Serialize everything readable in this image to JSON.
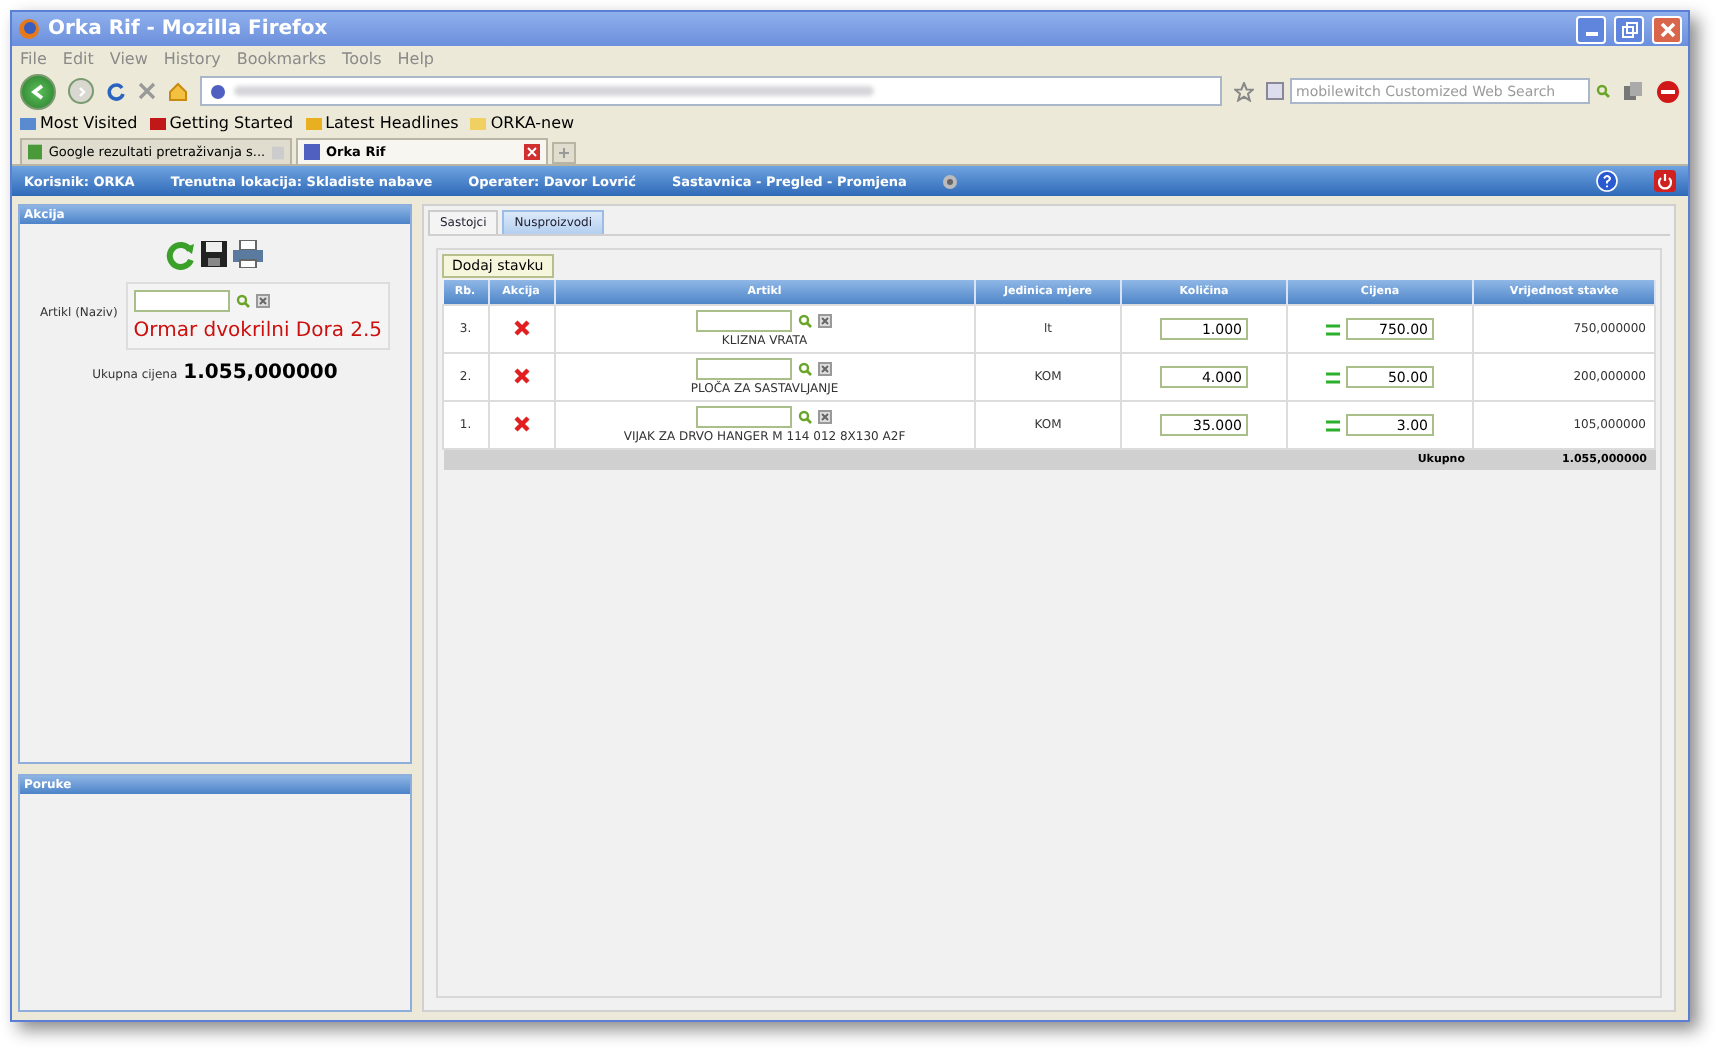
{
  "window": {
    "title": "Orka Rif - Mozilla Firefox"
  },
  "menu": [
    "File",
    "Edit",
    "View",
    "History",
    "Bookmarks",
    "Tools",
    "Help"
  ],
  "search": {
    "placeholder": "mobilewitch Customized Web Search"
  },
  "bookmarks": [
    {
      "label": "Most Visited"
    },
    {
      "label": "Getting Started"
    },
    {
      "label": "Latest Headlines"
    },
    {
      "label": "ORKA-new"
    }
  ],
  "browser_tabs": [
    {
      "label": "Google rezultati pretraživanja s...",
      "selected": false
    },
    {
      "label": "Orka Rif",
      "selected": true
    }
  ],
  "app_bar": {
    "items": [
      "Korisnik: ORKA",
      "Trenutna lokacija: Skladiste nabave",
      "Operater: Davor Lovrić",
      "Sastavnica - Pregled - Promjena"
    ]
  },
  "akcija_panel": {
    "title": "Akcija",
    "artikl_label": "Artikl (Naziv)",
    "product_name": "Ormar dvokrilni Dora 2.5",
    "total_label": "Ukupna cijena",
    "total_value": "1.055,000000"
  },
  "poruke_panel": {
    "title": "Poruke"
  },
  "content_tabs": [
    {
      "label": "Sastojci",
      "selected": true
    },
    {
      "label": "Nusproizvodi",
      "selected": false
    }
  ],
  "add_button": "Dodaj stavku",
  "table": {
    "columns": [
      "Rb.",
      "Akcija",
      "Artikl",
      "Jedinica mjere",
      "Količina",
      "Cijena",
      "Vrijednost stavke"
    ],
    "rows": [
      {
        "rb": "3.",
        "article": "KLIZNA VRATA",
        "unit": "lt",
        "quantity": "1.000",
        "price": "750.00",
        "value": "750,000000"
      },
      {
        "rb": "2.",
        "article": "PLOČA ZA SASTAVLJANJE",
        "unit": "KOM",
        "quantity": "4.000",
        "price": "50.00",
        "value": "200,000000"
      },
      {
        "rb": "1.",
        "article": "VIJAK ZA DRVO HANGER M 114 012 8X130 A2F",
        "unit": "KOM",
        "quantity": "35.000",
        "price": "3.00",
        "value": "105,000000"
      }
    ],
    "footer": {
      "label": "Ukupno",
      "value": "1.055,000000"
    }
  }
}
